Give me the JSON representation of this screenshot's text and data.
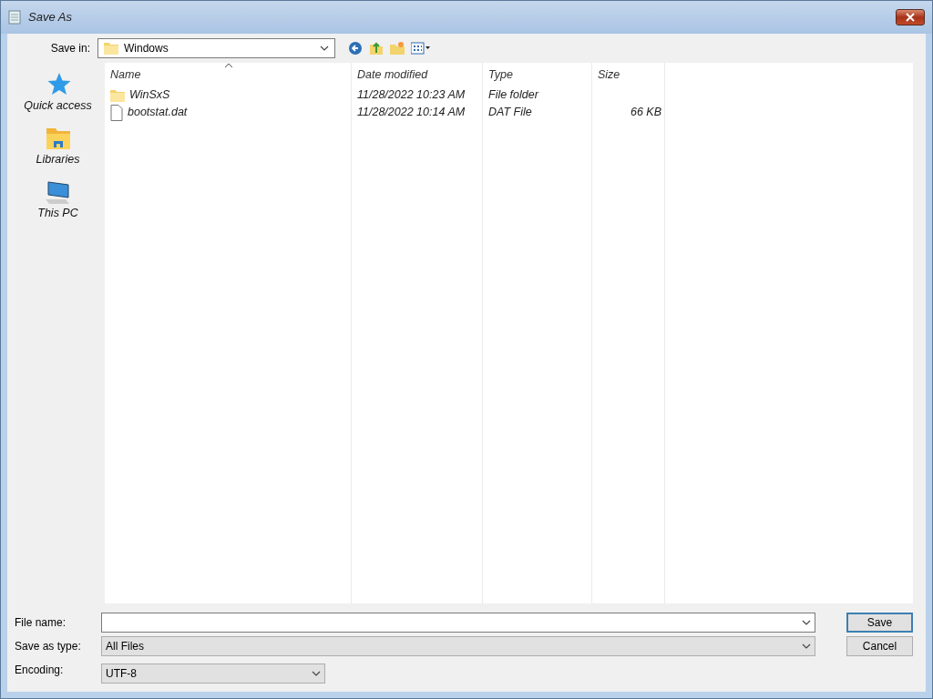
{
  "window": {
    "title": "Save As"
  },
  "toolbar": {
    "save_in_label": "Save in:",
    "location": "Windows"
  },
  "places": [
    {
      "label": "Quick access",
      "kind": "star"
    },
    {
      "label": "Libraries",
      "kind": "library"
    },
    {
      "label": "This PC",
      "kind": "computer"
    }
  ],
  "file_list": {
    "columns": [
      {
        "label": "Name",
        "sorted": true
      },
      {
        "label": "Date modified",
        "sorted": false
      },
      {
        "label": "Type",
        "sorted": false
      },
      {
        "label": "Size",
        "sorted": false
      }
    ],
    "rows": [
      {
        "kind": "folder",
        "name": "WinSxS",
        "date": "11/28/2022 10:23 AM",
        "type": "File folder"
      },
      {
        "kind": "file",
        "name": "bootstat.dat",
        "date": "11/28/2022 10:14 AM",
        "type": "DAT File",
        "size": "66 KB"
      }
    ]
  },
  "form": {
    "file_name_label": "File name:",
    "save_as_type_label": "Save as type:",
    "save_as_type": "All Files",
    "encoding_label": "Encoding:",
    "encoding": "UTF-8"
  },
  "buttons": [
    {
      "label": "Save",
      "default": true
    },
    {
      "label": "Cancel",
      "default": false
    }
  ]
}
